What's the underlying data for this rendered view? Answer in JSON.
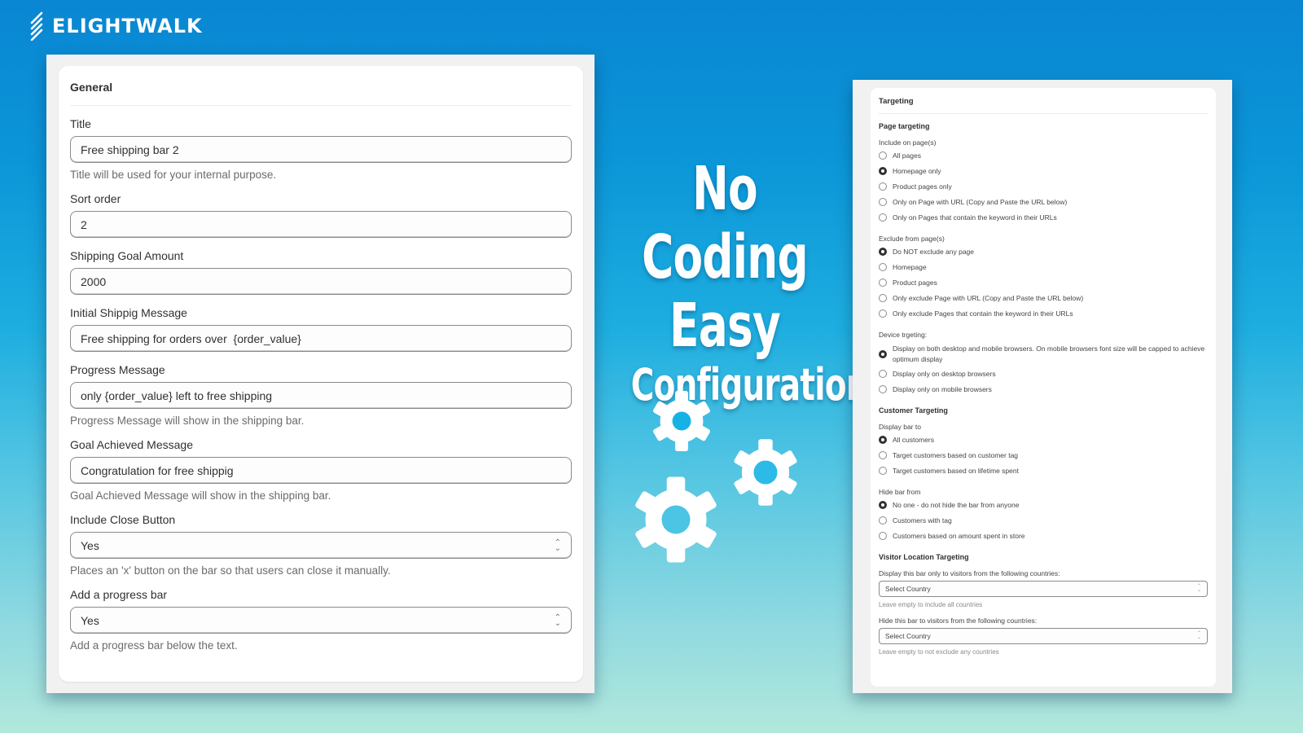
{
  "brand": {
    "name": "ELIGHTWALK",
    "logo_icon": "diagonal-stripes-icon"
  },
  "headline": {
    "line1": "No Coding",
    "line2": "Easy",
    "line3": "Configuration",
    "illustration": "gears-icon"
  },
  "general": {
    "title": "General",
    "fields": {
      "title": {
        "label": "Title",
        "value": "Free shipping bar 2",
        "help": "Title will be used for your internal purpose."
      },
      "sort_order": {
        "label": "Sort order",
        "value": "2"
      },
      "goal_amount": {
        "label": "Shipping Goal Amount",
        "value": "2000"
      },
      "initial_message": {
        "label": "Initial Shippig Message",
        "value": "Free shipping for orders over  {order_value}"
      },
      "progress_message": {
        "label": "Progress Message",
        "value": "only {order_value} left to free shipping",
        "help": "Progress Message will show in the shipping bar."
      },
      "goal_message": {
        "label": "Goal Achieved Message",
        "value": "Congratulation for free shippig",
        "help": "Goal Achieved Message will show in the shipping bar."
      },
      "close_button": {
        "label": "Include Close Button",
        "value": "Yes",
        "help": "Places an 'x' button on the bar so that users can close it manually."
      },
      "progress_bar": {
        "label": "Add a progress bar",
        "value": "Yes",
        "help": "Add a progress bar below the text."
      }
    }
  },
  "targeting": {
    "title": "Targeting",
    "page_targeting": {
      "heading": "Page targeting",
      "include": {
        "label": "Include on page(s)",
        "options": [
          {
            "label": "All pages",
            "selected": false
          },
          {
            "label": "Homepage only",
            "selected": true
          },
          {
            "label": "Product pages only",
            "selected": false
          },
          {
            "label": "Only on Page with URL (Copy and Paste the URL below)",
            "selected": false
          },
          {
            "label": "Only on Pages that contain the keyword in their URLs",
            "selected": false
          }
        ]
      },
      "exclude": {
        "label": "Exclude from page(s)",
        "options": [
          {
            "label": "Do NOT exclude any page",
            "selected": true
          },
          {
            "label": "Homepage",
            "selected": false
          },
          {
            "label": "Product pages",
            "selected": false
          },
          {
            "label": "Only exclude Page with URL (Copy and Paste the URL below)",
            "selected": false
          },
          {
            "label": "Only exclude Pages that contain the keyword in their URLs",
            "selected": false
          }
        ]
      },
      "device": {
        "label": "Device trgeting:",
        "options": [
          {
            "label": "Display on both desktop and mobile browsers. On mobile browsers font size will be capped to achieve optimum display",
            "selected": true
          },
          {
            "label": "Display only on desktop browsers",
            "selected": false
          },
          {
            "label": "Display only on mobile browsers",
            "selected": false
          }
        ]
      }
    },
    "customer_targeting": {
      "heading": "Customer Targeting",
      "display": {
        "label": "Display bar to",
        "options": [
          {
            "label": "All customers",
            "selected": true
          },
          {
            "label": "Target customers based on customer tag",
            "selected": false
          },
          {
            "label": "Target customers based on lifetime spent",
            "selected": false
          }
        ]
      },
      "hide": {
        "label": "Hide bar from",
        "options": [
          {
            "label": "No one - do not hide the bar from anyone",
            "selected": true
          },
          {
            "label": "Customers with tag",
            "selected": false
          },
          {
            "label": "Customers based on amount spent in store",
            "selected": false
          }
        ]
      }
    },
    "location": {
      "heading": "Visitor Location Targeting",
      "include": {
        "label": "Display this bar only to visitors from the following countries:",
        "value": "Select Country",
        "help": "Leave empty to include all countries"
      },
      "exclude": {
        "label": "Hide this bar to visitors from the following countries:",
        "value": "Select Country",
        "help": "Leave empty to not exclude any countries"
      }
    }
  }
}
